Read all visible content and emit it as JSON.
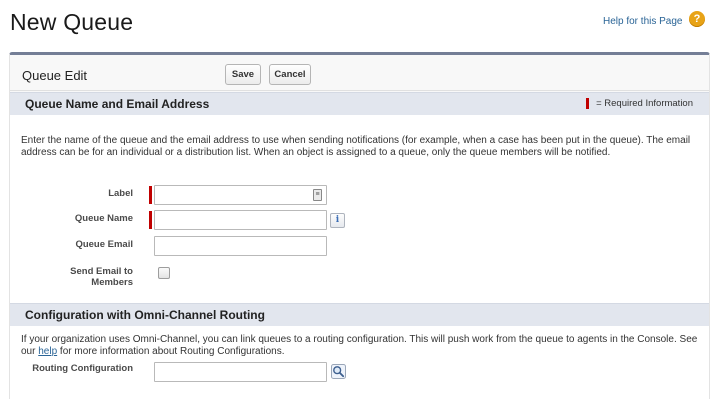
{
  "header": {
    "title": "New Queue",
    "help_link": "Help for this Page",
    "help_icon": "question-icon"
  },
  "panel": {
    "title": "Queue Edit",
    "save_label": "Save",
    "cancel_label": "Cancel"
  },
  "section1": {
    "title": "Queue Name and Email Address",
    "required_legend": "= Required Information",
    "description": "Enter the name of the queue and the email address to use when sending notifications (for example, when a case has been put in the queue). The email address can be for an individual or a distribution list. When an object is assigned to a queue, only the queue members will be notified.",
    "fields": {
      "label": {
        "label": "Label",
        "value": ""
      },
      "queue_name": {
        "label": "Queue Name",
        "value": ""
      },
      "queue_email": {
        "label": "Queue Email",
        "value": ""
      },
      "send_email_line1": "Send Email to",
      "send_email_line2": "Members",
      "send_email_checked": false
    }
  },
  "section2": {
    "title": "Configuration with Omni-Channel Routing",
    "description_before": "If your organization uses Omni-Channel, you can link queues to a routing configuration. This will push work from the queue to agents in the Console. See our ",
    "help_link": "help",
    "description_after": " for more information about Routing Configurations.",
    "routing_label": "Routing Configuration",
    "routing_value": ""
  },
  "colors": {
    "required": "#c00000",
    "section_bar": "#e2e6ee",
    "panel_border": "#747e96",
    "link": "#2a6496",
    "help_icon": "#e8a317"
  }
}
